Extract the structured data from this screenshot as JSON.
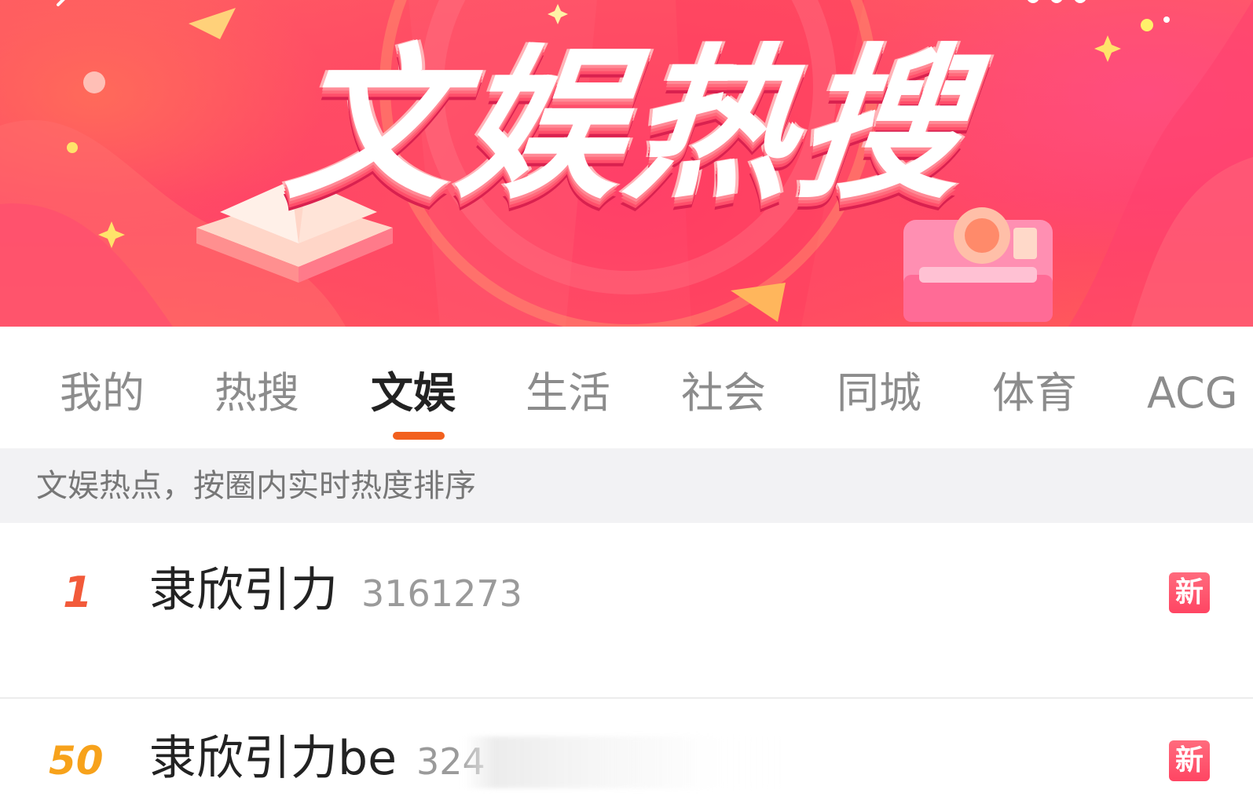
{
  "banner": {
    "title": "文娱热搜"
  },
  "tabs": [
    {
      "label": "我的"
    },
    {
      "label": "热搜"
    },
    {
      "label": "文娱"
    },
    {
      "label": "生活"
    },
    {
      "label": "社会"
    },
    {
      "label": "同城"
    },
    {
      "label": "体育"
    },
    {
      "label": "ACG"
    }
  ],
  "active_tab": "文娱",
  "hint": "文娱热点，按圈内实时热度排序",
  "items": [
    {
      "rank": "1",
      "topic": "隶欣引力",
      "count": "3161273",
      "badge": "新"
    },
    {
      "rank": "50",
      "topic": "隶欣引力be",
      "count": "324",
      "badge": "新"
    }
  ],
  "colors": {
    "accent": "#f2601e",
    "rank_top": "#f25a3a",
    "rank_other": "#f7a21b",
    "badge": "#ff4f6b",
    "banner": "#ff4169"
  }
}
